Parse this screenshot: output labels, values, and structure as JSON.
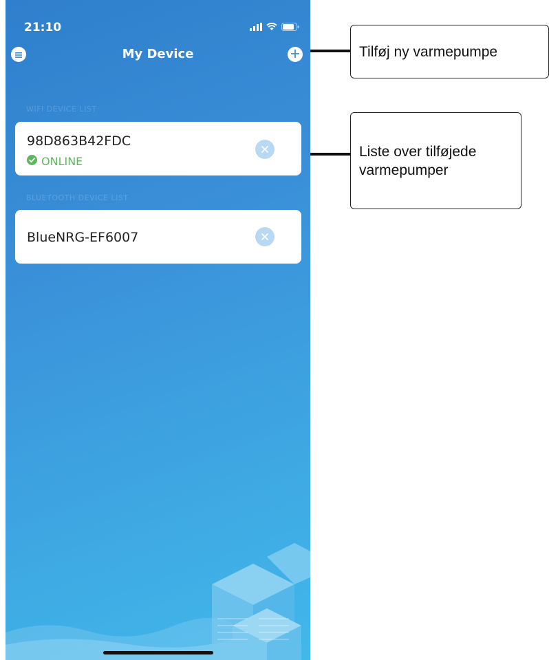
{
  "status_bar": {
    "time": "21:10",
    "icons": [
      "signal-icon",
      "wifi-icon",
      "battery-icon"
    ]
  },
  "nav": {
    "title": "My Device",
    "left_icon": "menu-icon",
    "right_icon": "plus-icon"
  },
  "sections": {
    "wifi_header": "WIFI DEVICE LIST",
    "bluetooth_header": "BLUETOOTH DEVICE LIST"
  },
  "wifi_devices": [
    {
      "name": "98D863B42FDC",
      "status": "ONLINE",
      "status_color": "#5cb85c"
    }
  ],
  "bluetooth_devices": [
    {
      "name": "BlueNRG-EF6007"
    }
  ],
  "callouts": {
    "add_pump": "Tilføj ny varmepumpe",
    "list_pumps": "Liste over tilføjede varmepumper"
  },
  "colors": {
    "background_top": "#2f7fcc",
    "background_bottom": "#41b8ea",
    "online": "#5cb85c"
  }
}
